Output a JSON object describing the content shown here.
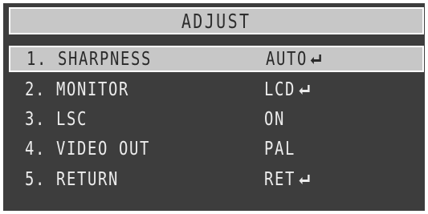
{
  "menu": {
    "title": "ADJUST",
    "items": [
      {
        "label": "1. SHARPNESS",
        "value": "AUTO",
        "enter_icon": "enter-arrow-icon",
        "selected": true
      },
      {
        "label": "2. MONITOR",
        "value": "LCD",
        "enter_icon": "enter-arrow-icon",
        "selected": false
      },
      {
        "label": "3. LSC",
        "value": "ON",
        "enter_icon": null,
        "selected": false
      },
      {
        "label": "4. VIDEO OUT",
        "value": "PAL",
        "enter_icon": null,
        "selected": false
      },
      {
        "label": "5. RETURN",
        "value": "RET",
        "enter_icon": "enter-arrow-icon",
        "selected": false
      }
    ]
  },
  "colors": {
    "background": "#3d3d3d",
    "highlight": "#c7c7c7",
    "text": "#ececec",
    "highlight_text": "#2a2a2a"
  }
}
